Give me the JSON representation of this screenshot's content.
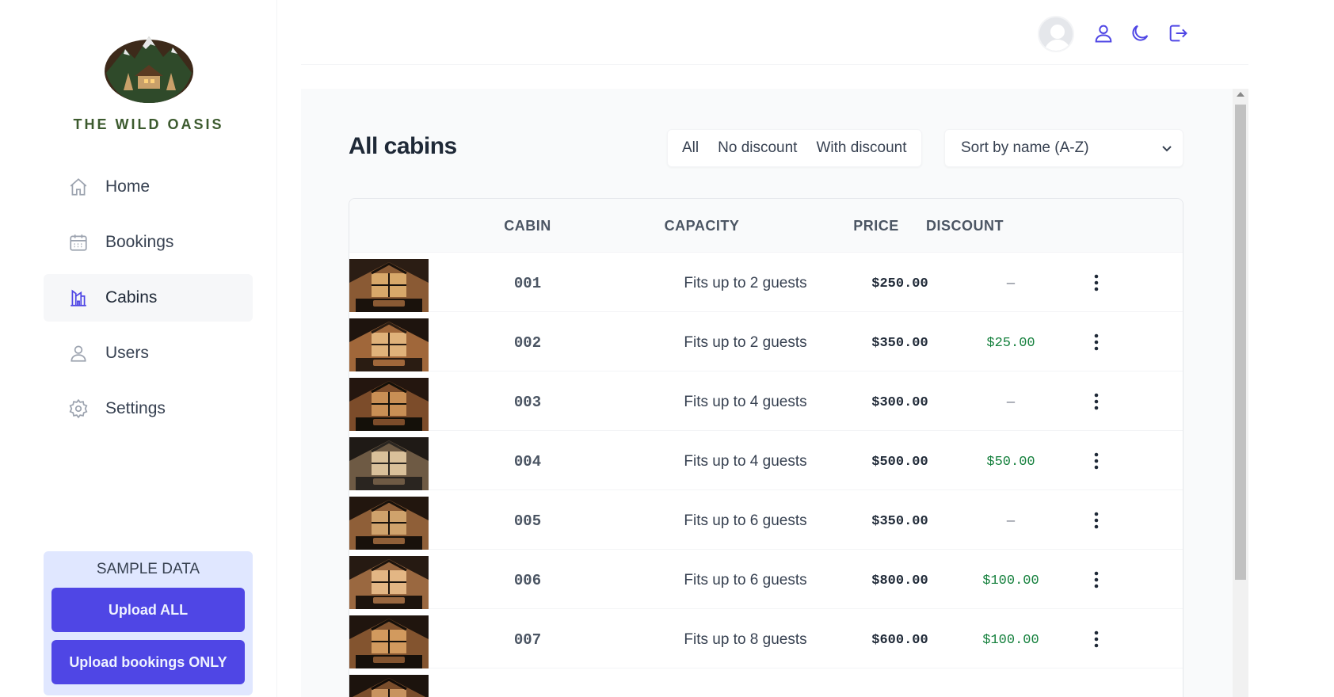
{
  "brand": {
    "name": "THE WILD OASIS"
  },
  "nav": [
    {
      "label": "Home",
      "icon": "home-icon",
      "active": false
    },
    {
      "label": "Bookings",
      "icon": "calendar-icon",
      "active": false
    },
    {
      "label": "Cabins",
      "icon": "cabin-icon",
      "active": true
    },
    {
      "label": "Users",
      "icon": "user-icon",
      "active": false
    },
    {
      "label": "Settings",
      "icon": "gear-icon",
      "active": false
    }
  ],
  "sample_data": {
    "title": "SAMPLE DATA",
    "upload_all": "Upload ALL",
    "upload_bookings": "Upload bookings ONLY"
  },
  "header": {
    "icons": [
      "avatar",
      "user-icon",
      "moon-icon",
      "logout-icon"
    ]
  },
  "page": {
    "title": "All cabins",
    "filters": [
      "All",
      "No discount",
      "With discount"
    ],
    "sort_value": "Sort by name (A-Z)"
  },
  "table": {
    "columns": [
      "CABIN",
      "CAPACITY",
      "PRICE",
      "DISCOUNT"
    ],
    "rows": [
      {
        "name": "001",
        "capacity": "Fits up to 2 guests",
        "price": "$250.00",
        "discount": "—"
      },
      {
        "name": "002",
        "capacity": "Fits up to 2 guests",
        "price": "$350.00",
        "discount": "$25.00"
      },
      {
        "name": "003",
        "capacity": "Fits up to 4 guests",
        "price": "$300.00",
        "discount": "—"
      },
      {
        "name": "004",
        "capacity": "Fits up to 4 guests",
        "price": "$500.00",
        "discount": "$50.00"
      },
      {
        "name": "005",
        "capacity": "Fits up to 6 guests",
        "price": "$350.00",
        "discount": "—"
      },
      {
        "name": "006",
        "capacity": "Fits up to 6 guests",
        "price": "$800.00",
        "discount": "$100.00"
      },
      {
        "name": "007",
        "capacity": "Fits up to 8 guests",
        "price": "$600.00",
        "discount": "$100.00"
      },
      {
        "name": "",
        "capacity": "",
        "price": "",
        "discount": ""
      }
    ]
  },
  "colors": {
    "accent": "#4f46e5",
    "discount": "#15803d",
    "brand_green": "#3c5a2e",
    "sample_bg": "#e0e7ff"
  }
}
